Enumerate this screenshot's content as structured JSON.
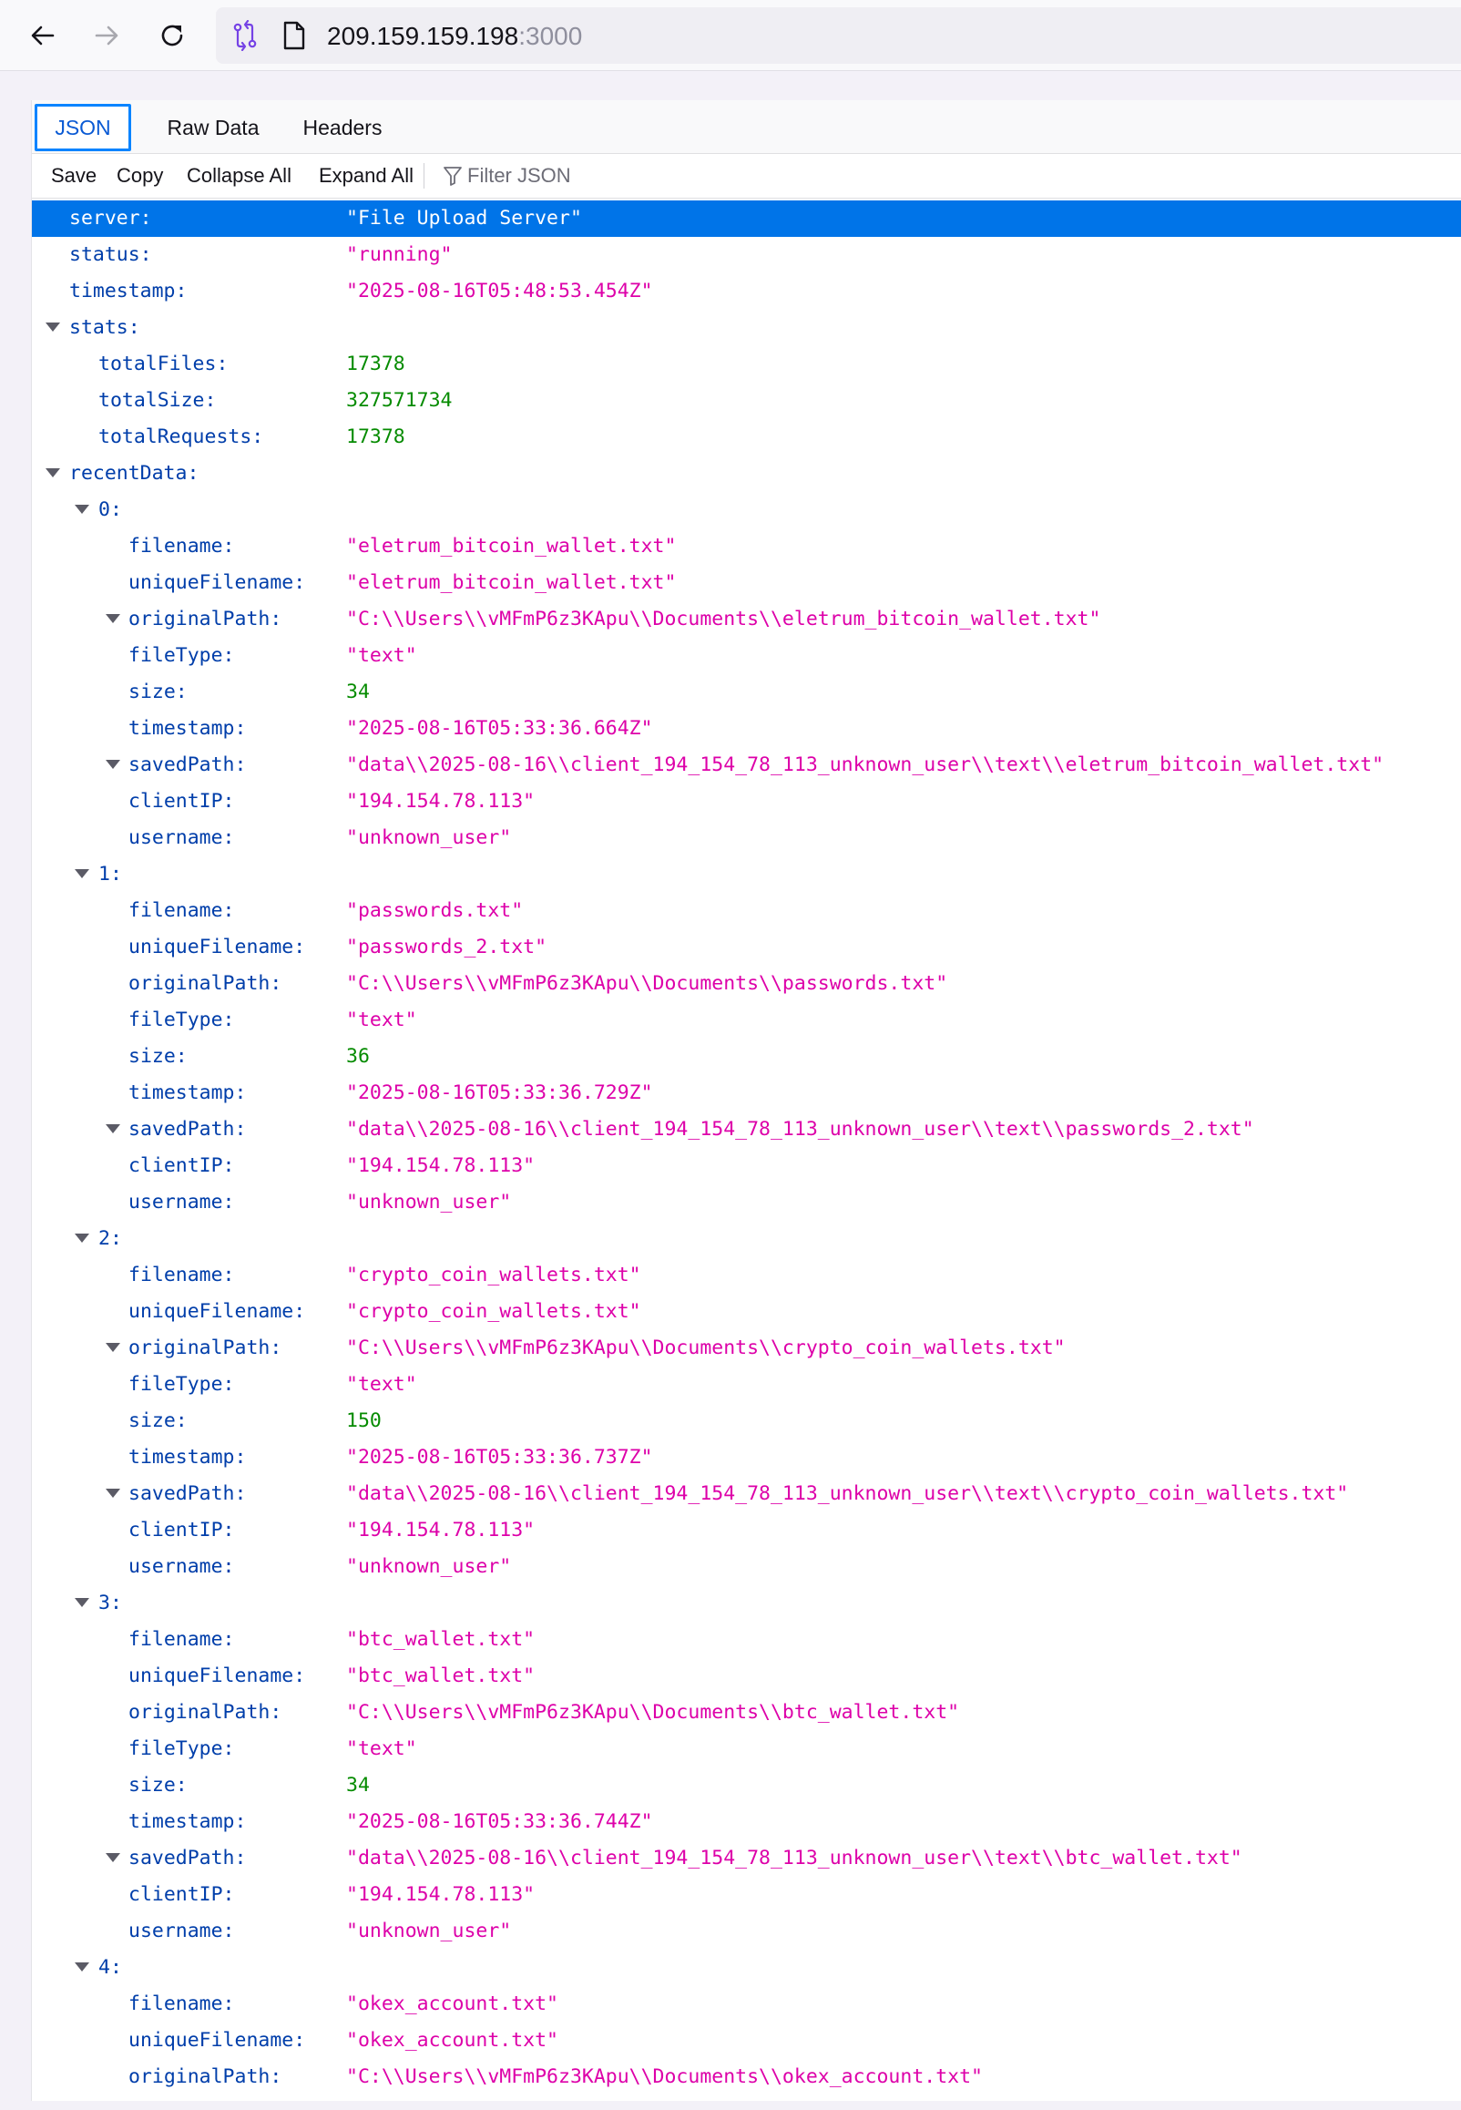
{
  "browser": {
    "url_host": "209.159.159.198",
    "url_port": ":3000"
  },
  "viewer": {
    "tabs": [
      "JSON",
      "Raw Data",
      "Headers"
    ],
    "toolbar": {
      "save": "Save",
      "copy": "Copy",
      "collapse_all": "Collapse All",
      "expand_all": "Expand All",
      "filter_placeholder": "Filter JSON"
    }
  },
  "json_rows": [
    {
      "level": 0,
      "key": "server:",
      "value": "\"File Upload Server\"",
      "type": "str",
      "selected": true
    },
    {
      "level": 0,
      "key": "status:",
      "value": "\"running\"",
      "type": "str"
    },
    {
      "level": 0,
      "key": "timestamp:",
      "value": "\"2025-08-16T05:48:53.454Z\"",
      "type": "str"
    },
    {
      "level": 0,
      "key": "stats:",
      "twisty": true
    },
    {
      "level": 1,
      "key": "totalFiles:",
      "value": "17378",
      "type": "num"
    },
    {
      "level": 1,
      "key": "totalSize:",
      "value": "327571734",
      "type": "num"
    },
    {
      "level": 1,
      "key": "totalRequests:",
      "value": "17378",
      "type": "num"
    },
    {
      "level": 0,
      "key": "recentData:",
      "twisty": true
    },
    {
      "level": 1,
      "key": "0:",
      "twisty": true
    },
    {
      "level": 2,
      "key": "filename:",
      "value": "\"eletrum_bitcoin_wallet.txt\"",
      "type": "str"
    },
    {
      "level": 2,
      "key": "uniqueFilename:",
      "value": "\"eletrum_bitcoin_wallet.txt\"",
      "type": "str"
    },
    {
      "level": 2,
      "key": "originalPath:",
      "value": "\"C:\\\\Users\\\\vMFmP6z3KApu\\\\Documents\\\\eletrum_bitcoin_wallet.txt\"",
      "type": "str",
      "twisty": true
    },
    {
      "level": 2,
      "key": "fileType:",
      "value": "\"text\"",
      "type": "str"
    },
    {
      "level": 2,
      "key": "size:",
      "value": "34",
      "type": "num"
    },
    {
      "level": 2,
      "key": "timestamp:",
      "value": "\"2025-08-16T05:33:36.664Z\"",
      "type": "str"
    },
    {
      "level": 2,
      "key": "savedPath:",
      "value": "\"data\\\\2025-08-16\\\\client_194_154_78_113_unknown_user\\\\text\\\\eletrum_bitcoin_wallet.txt\"",
      "type": "str",
      "twisty": true
    },
    {
      "level": 2,
      "key": "clientIP:",
      "value": "\"194.154.78.113\"",
      "type": "str"
    },
    {
      "level": 2,
      "key": "username:",
      "value": "\"unknown_user\"",
      "type": "str"
    },
    {
      "level": 1,
      "key": "1:",
      "twisty": true
    },
    {
      "level": 2,
      "key": "filename:",
      "value": "\"passwords.txt\"",
      "type": "str"
    },
    {
      "level": 2,
      "key": "uniqueFilename:",
      "value": "\"passwords_2.txt\"",
      "type": "str"
    },
    {
      "level": 2,
      "key": "originalPath:",
      "value": "\"C:\\\\Users\\\\vMFmP6z3KApu\\\\Documents\\\\passwords.txt\"",
      "type": "str"
    },
    {
      "level": 2,
      "key": "fileType:",
      "value": "\"text\"",
      "type": "str"
    },
    {
      "level": 2,
      "key": "size:",
      "value": "36",
      "type": "num"
    },
    {
      "level": 2,
      "key": "timestamp:",
      "value": "\"2025-08-16T05:33:36.729Z\"",
      "type": "str"
    },
    {
      "level": 2,
      "key": "savedPath:",
      "value": "\"data\\\\2025-08-16\\\\client_194_154_78_113_unknown_user\\\\text\\\\passwords_2.txt\"",
      "type": "str",
      "twisty": true
    },
    {
      "level": 2,
      "key": "clientIP:",
      "value": "\"194.154.78.113\"",
      "type": "str"
    },
    {
      "level": 2,
      "key": "username:",
      "value": "\"unknown_user\"",
      "type": "str"
    },
    {
      "level": 1,
      "key": "2:",
      "twisty": true
    },
    {
      "level": 2,
      "key": "filename:",
      "value": "\"crypto_coin_wallets.txt\"",
      "type": "str"
    },
    {
      "level": 2,
      "key": "uniqueFilename:",
      "value": "\"crypto_coin_wallets.txt\"",
      "type": "str"
    },
    {
      "level": 2,
      "key": "originalPath:",
      "value": "\"C:\\\\Users\\\\vMFmP6z3KApu\\\\Documents\\\\crypto_coin_wallets.txt\"",
      "type": "str",
      "twisty": true
    },
    {
      "level": 2,
      "key": "fileType:",
      "value": "\"text\"",
      "type": "str"
    },
    {
      "level": 2,
      "key": "size:",
      "value": "150",
      "type": "num"
    },
    {
      "level": 2,
      "key": "timestamp:",
      "value": "\"2025-08-16T05:33:36.737Z\"",
      "type": "str"
    },
    {
      "level": 2,
      "key": "savedPath:",
      "value": "\"data\\\\2025-08-16\\\\client_194_154_78_113_unknown_user\\\\text\\\\crypto_coin_wallets.txt\"",
      "type": "str",
      "twisty": true
    },
    {
      "level": 2,
      "key": "clientIP:",
      "value": "\"194.154.78.113\"",
      "type": "str"
    },
    {
      "level": 2,
      "key": "username:",
      "value": "\"unknown_user\"",
      "type": "str"
    },
    {
      "level": 1,
      "key": "3:",
      "twisty": true
    },
    {
      "level": 2,
      "key": "filename:",
      "value": "\"btc_wallet.txt\"",
      "type": "str"
    },
    {
      "level": 2,
      "key": "uniqueFilename:",
      "value": "\"btc_wallet.txt\"",
      "type": "str"
    },
    {
      "level": 2,
      "key": "originalPath:",
      "value": "\"C:\\\\Users\\\\vMFmP6z3KApu\\\\Documents\\\\btc_wallet.txt\"",
      "type": "str"
    },
    {
      "level": 2,
      "key": "fileType:",
      "value": "\"text\"",
      "type": "str"
    },
    {
      "level": 2,
      "key": "size:",
      "value": "34",
      "type": "num"
    },
    {
      "level": 2,
      "key": "timestamp:",
      "value": "\"2025-08-16T05:33:36.744Z\"",
      "type": "str"
    },
    {
      "level": 2,
      "key": "savedPath:",
      "value": "\"data\\\\2025-08-16\\\\client_194_154_78_113_unknown_user\\\\text\\\\btc_wallet.txt\"",
      "type": "str",
      "twisty": true
    },
    {
      "level": 2,
      "key": "clientIP:",
      "value": "\"194.154.78.113\"",
      "type": "str"
    },
    {
      "level": 2,
      "key": "username:",
      "value": "\"unknown_user\"",
      "type": "str"
    },
    {
      "level": 1,
      "key": "4:",
      "twisty": true
    },
    {
      "level": 2,
      "key": "filename:",
      "value": "\"okex_account.txt\"",
      "type": "str"
    },
    {
      "level": 2,
      "key": "uniqueFilename:",
      "value": "\"okex_account.txt\"",
      "type": "str"
    },
    {
      "level": 2,
      "key": "originalPath:",
      "value": "\"C:\\\\Users\\\\vMFmP6z3KApu\\\\Documents\\\\okex_account.txt\"",
      "type": "str"
    }
  ]
}
